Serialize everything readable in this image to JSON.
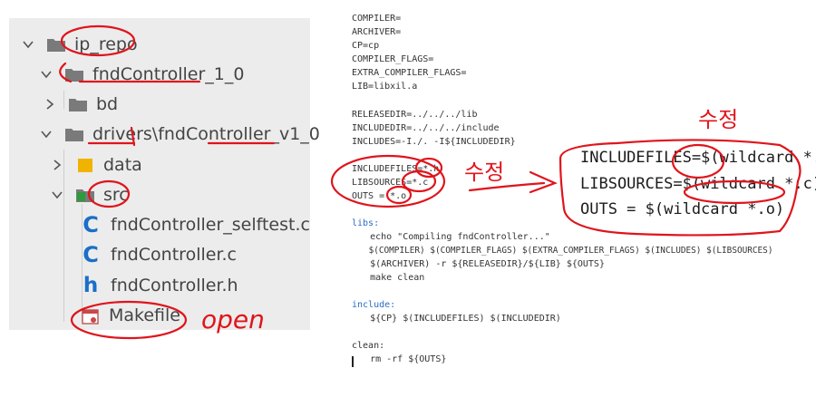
{
  "tree": {
    "items": [
      {
        "label": "ip_repo",
        "icon": "folder",
        "expanded": true
      },
      {
        "label": "fndController_1_0",
        "icon": "folder",
        "expanded": true
      },
      {
        "label": "bd",
        "icon": "folder",
        "expanded": false
      },
      {
        "label": "drivers\\fndController_v1_0",
        "icon": "folder",
        "expanded": true
      },
      {
        "label": "data",
        "icon": "folder-yellow",
        "expanded": false
      },
      {
        "label": "src",
        "icon": "folder-src",
        "expanded": true
      },
      {
        "label": "fndController_selftest.c",
        "icon": "c-file"
      },
      {
        "label": "fndController.c",
        "icon": "c-file"
      },
      {
        "label": "fndController.h",
        "icon": "h-file"
      },
      {
        "label": "Makefile",
        "icon": "makefile"
      }
    ]
  },
  "makefile": {
    "lines": [
      "COMPILER=",
      "ARCHIVER=",
      "CP=cp",
      "COMPILER_FLAGS=",
      "EXTRA_COMPILER_FLAGS=",
      "LIB=libxil.a",
      "",
      "RELEASEDIR=../../../lib",
      "INCLUDEDIR=../../../include",
      "INCLUDES=-I./. -I${INCLUDEDIR}",
      "",
      "INCLUDEFILES=*.h",
      "LIBSOURCES=*.c",
      "OUTS = *.o",
      "",
      "libs:",
      "    echo \"Compiling fndController...\"",
      "    $(COMPILER) $(COMPILER_FLAGS) $(EXTRA_COMPILER_FLAGS) $(INCLUDES) $(LIBSOURCES)",
      "    $(ARCHIVER) -r ${RELEASEDIR}/${LIB} ${OUTS}",
      "    make clean",
      "",
      "include:",
      "    ${CP} $(INCLUDEFILES) $(INCLUDEDIR)",
      "",
      "clean:",
      "    rm -rf ${OUTS}"
    ]
  },
  "zoomed": {
    "lines": [
      "INCLUDEFILES=$(wildcard *.h)",
      "LIBSOURCES=$(wildcard *.c)",
      "OUTS = $(wildcard *.o)"
    ]
  },
  "annotations": {
    "open": "open",
    "edit_1": "수정",
    "edit_2": "수정"
  },
  "colors": {
    "ink": "#e0141c",
    "keyword": "#2b6cc4",
    "file_icon": "#1a6ec9",
    "panel_bg": "#ececec"
  }
}
